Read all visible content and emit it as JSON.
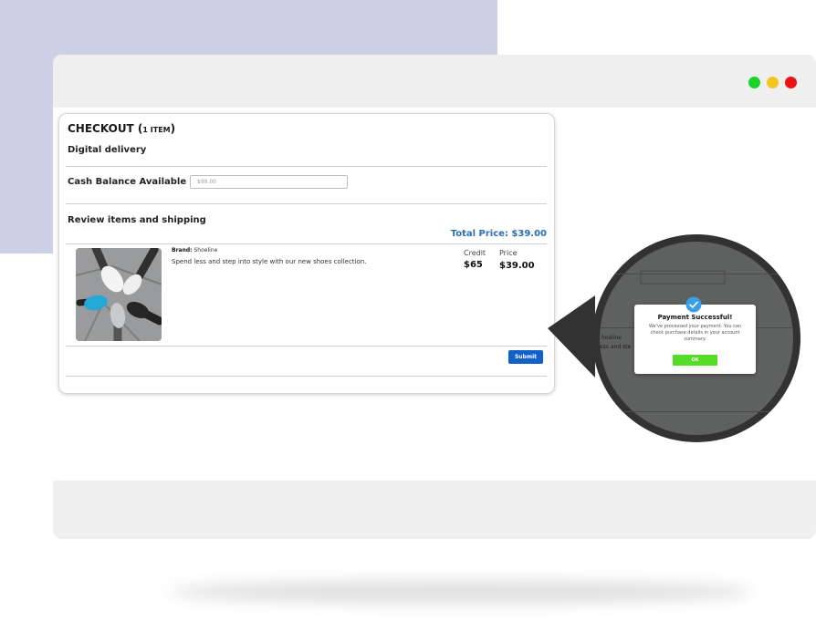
{
  "window": {
    "controls": {
      "minimize_color": "#1dd22a",
      "maximize_color": "#f4c521",
      "close_color": "#ee1111"
    }
  },
  "checkout": {
    "title": "CHECKOUT (",
    "item_count": "1 ITEM",
    "title_end": ")",
    "delivery_label": "Digital delivery",
    "cash_balance_label": "Cash Balance Available",
    "cash_balance_value": "$99.00",
    "review_label": "Review items and shipping",
    "total_price": "Total Price: $39.00",
    "item": {
      "image_icon": "sneakers-photo",
      "brand_label": "Brand:",
      "brand_value": "Shoeline",
      "description": "Spend less and step into style with our new shoes collection.",
      "credit_header": "Credit",
      "credit_value": "$65",
      "price_header": "Price",
      "price_value": "$39.00"
    },
    "submit_label": "Submit",
    "accent_color": "#2c6fb4"
  },
  "callout": {
    "background_brand": "hoeline",
    "background_desc": "ess and ste",
    "modal": {
      "icon": "checkmark-badge-icon",
      "title": "Payment Successful!",
      "message": "We've processed your payment. You can check purchase details in your account summary.",
      "ok_label": "OK",
      "ok_color": "#55dc25"
    }
  }
}
